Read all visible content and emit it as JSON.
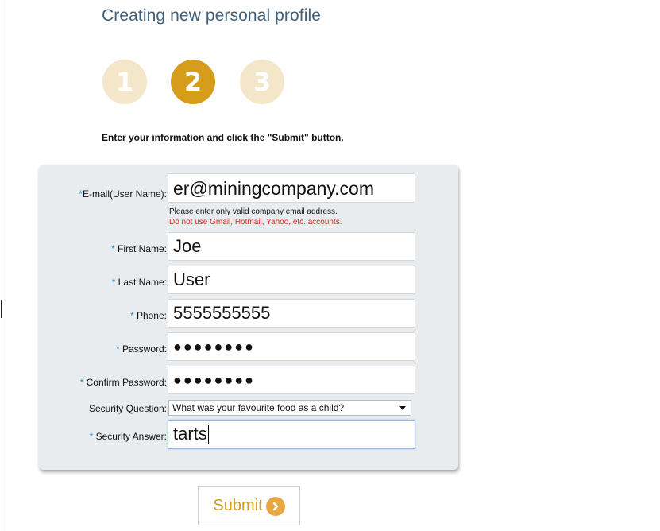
{
  "page": {
    "title": "Creating new personal profile",
    "instruction": "Enter your information and click the \"Submit\" button."
  },
  "steps": [
    {
      "number": "1",
      "state": "inactive"
    },
    {
      "number": "2",
      "state": "active"
    },
    {
      "number": "3",
      "state": "inactive"
    }
  ],
  "form": {
    "required_marker": "*",
    "email": {
      "label": "E-mail(User Name):",
      "value": "er@miningcompany.com",
      "hint": "Please enter only valid company email address.",
      "warning": "Do not use Gmail, Hotmail, Yahoo, etc. accounts."
    },
    "first_name": {
      "label": "First Name:",
      "value": "Joe"
    },
    "last_name": {
      "label": "Last Name:",
      "value": "User"
    },
    "phone": {
      "label": "Phone:",
      "value": "5555555555"
    },
    "password": {
      "label": "Password:",
      "value": "●●●●●●●●"
    },
    "confirm_password": {
      "label": "Confirm Password:",
      "value": "●●●●●●●●"
    },
    "security_question": {
      "label": "Security Question:",
      "value": "What was your favourite food as a child?"
    },
    "security_answer": {
      "label": "Security Answer:",
      "value": "tarts"
    }
  },
  "submit": {
    "label": "Submit"
  },
  "colors": {
    "accent": "#d59d1a",
    "accent_light": "#f3e6c9",
    "required": "#3a8fc4",
    "warning": "#e0241c",
    "title": "#3f5f7a"
  }
}
